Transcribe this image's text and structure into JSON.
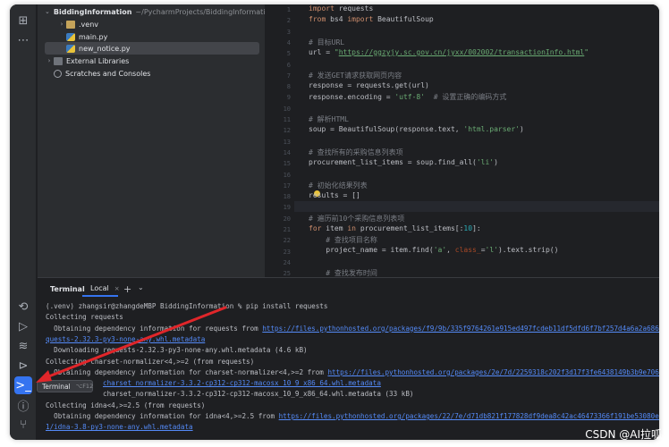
{
  "project_tree": {
    "root": {
      "name": "BiddingInformation",
      "path": "~/PycharmProjects/BiddingInformation"
    },
    "items": [
      {
        "label": ".venv",
        "kind": "folder"
      },
      {
        "label": "main.py",
        "kind": "py"
      },
      {
        "label": "new_notice.py",
        "kind": "py",
        "selected": true
      },
      {
        "label": "External Libraries",
        "kind": "lib"
      },
      {
        "label": "Scratches and Consoles",
        "kind": "scratch"
      }
    ]
  },
  "editor": {
    "line_numbers": [
      "1",
      "2",
      "3",
      "4",
      "5",
      "6",
      "7",
      "8",
      "9",
      "10",
      "11",
      "12",
      "13",
      "14",
      "15",
      "16",
      "17",
      "18",
      "19",
      "20",
      "21",
      "22",
      "23",
      "24",
      "25"
    ]
  },
  "terminal": {
    "title": "Terminal",
    "tab_label": "Local",
    "tab_close": "×",
    "add_label": "+",
    "more_label": "⌄",
    "tooltip": {
      "label": "Terminal",
      "shortcut": "⌥F12"
    },
    "lines": [
      {
        "text": "(.venv) zhangsir@zhangdeMBP BiddingInformation % pip install requests"
      },
      {
        "text": "Collecting requests"
      },
      {
        "text": "  Obtaining dependency information for requests from ",
        "link": "https://files.pythonhosted.org/packages/f9/9b/335f9764261e915ed497fcdeb11df5dfd6f7bf257d4a6a2a686d80da4d"
      },
      {
        "text": "",
        "link": "quests-2.32.3-py3-none-any.whl.metadata"
      },
      {
        "text": "  Downloading requests-2.32.3-py3-none-any.whl.metadata (4.6 kB)"
      },
      {
        "text": "Collecting charset-normalizer<4,>=2 (from requests)"
      },
      {
        "text": "  Obtaining dependency information for charset-normalizer<4,>=2 from ",
        "link": "https://files.pythonhosted.org/packages/2e/7d/2259318c202f3d17f3fe6438149b3b9e706d1070fe"
      },
      {
        "text": "              ",
        "link": "charset_normalizer-3.3.2-cp312-cp312-macosx_10_9_x86_64.whl.metadata"
      },
      {
        "text": "              charset_normalizer-3.3.2-cp312-cp312-macosx_10_9_x86_64.whl.metadata (33 kB)"
      },
      {
        "text": "Collecting idna<4,>=2.5 (from requests)"
      },
      {
        "text": "  Obtaining dependency information for idna<4,>=2.5 from ",
        "link": "https://files.pythonhosted.org/packages/22/7e/d71db821f177828df9dea8c42ac46473366f191be53080e552e628"
      },
      {
        "text": "",
        "link": "1/idna-3.8-py3-none-any.whl.metadata"
      }
    ]
  },
  "watermark": "CSDN @AI拉呱",
  "colors": {
    "accent": "#3574f0",
    "annotation_arrow": "#e0262a"
  }
}
